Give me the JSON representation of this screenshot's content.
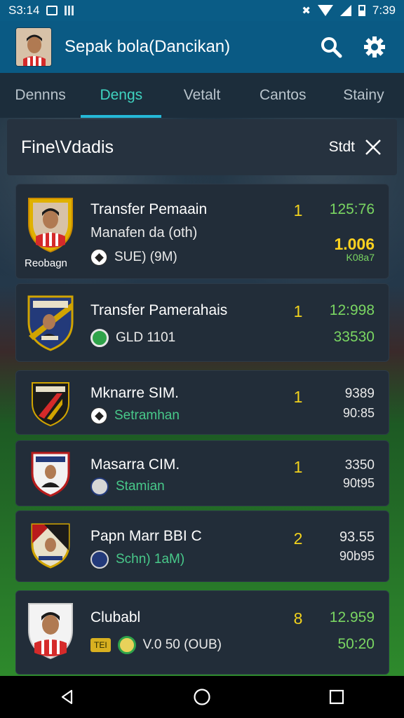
{
  "status_bar": {
    "time_left": "S3:14",
    "time_right": "7:39"
  },
  "app_bar": {
    "title": "Sepak bola(Dancikan)"
  },
  "tabs": [
    {
      "label": "Dennns",
      "active": false
    },
    {
      "label": "Dengs",
      "active": true
    },
    {
      "label": "Vetalt",
      "active": false
    },
    {
      "label": "Cantos",
      "active": false
    },
    {
      "label": "Stainy",
      "active": false
    }
  ],
  "filter": {
    "title": "Fine\\Vdadis",
    "sort_label": "Stdt"
  },
  "cards": [
    {
      "name": "Transfer Pemaain",
      "subtitle": "Manafen da (oth)",
      "meta": "SUE) (9M)",
      "crest_label": "Reobagn",
      "rank": "1",
      "value_top": "125:76",
      "value_main": "1.006",
      "value_bottom": "K08a7"
    },
    {
      "name": "Transfer Pamerahais",
      "meta": "GLD 1101",
      "rank": "1",
      "value_top": "12:998",
      "value_bottom": "33530"
    },
    {
      "name": "Mknarre SIM.",
      "meta": "Setramhan",
      "rank": "1",
      "value_top": "9389",
      "value_bottom": "90:85"
    },
    {
      "name": "Masarra CIM.",
      "meta": "Stamian",
      "rank": "1",
      "value_top": "3350",
      "value_bottom": "90t95"
    },
    {
      "name": "Papn Marr BBI C",
      "meta": "Schn) 1aM)",
      "rank": "2",
      "value_top": "93.55",
      "value_bottom": "90b95"
    },
    {
      "name": "Clubabl",
      "meta_badge": "TEI",
      "meta": "V.0 50 (OUB)",
      "rank": "8",
      "value_top": "12.959",
      "value_bottom": "50:20"
    }
  ],
  "colors": {
    "accent": "#25b9d8",
    "active_tab": "#3fd3c0",
    "appbar": "#0a5a84",
    "rank": "#f2d21d",
    "value_green": "#7ad662"
  },
  "icons": [
    "search-icon",
    "settings-gear-icon",
    "close-icon",
    "back-icon",
    "home-icon",
    "recents-icon"
  ]
}
